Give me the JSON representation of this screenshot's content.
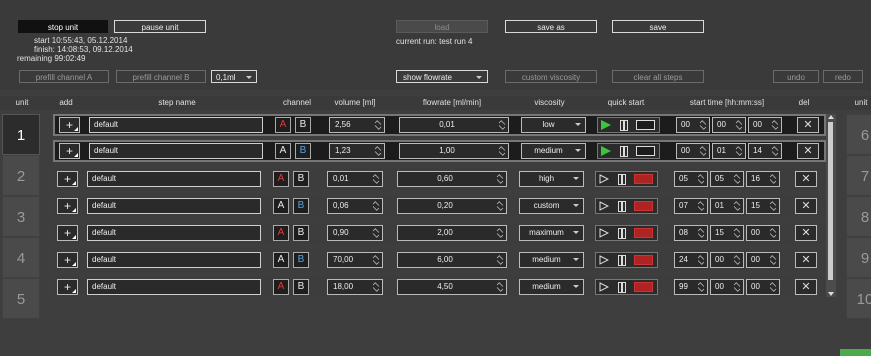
{
  "toolbar": {
    "stop_unit": "stop unit",
    "pause_unit": "pause unit",
    "load": "load",
    "save_as": "save as",
    "save": "save",
    "start": "start 10:55:43, 05.12.2014",
    "finish": "finish: 14:08:53, 09.12.2014",
    "remaining": "remaining 99:02:49",
    "current_run": "current run: test run 4",
    "prefill_a": "prefill channel A",
    "prefill_b": "prefill channel B",
    "prefill_amount": "0,1ml",
    "show_flowrate": "show flowrate",
    "custom_viscosity": "custom viscosity",
    "clear_all_steps": "clear all steps",
    "undo": "undo",
    "redo": "redo"
  },
  "headers": {
    "unit_left": "unit",
    "add": "add",
    "step_name": "step name",
    "channel": "channel",
    "volume": "volume [ml]",
    "flowrate": "flowrate [ml/min]",
    "viscosity": "viscosity",
    "quick_start": "quick start",
    "start_time": "start time [hh:mm:ss]",
    "del": "del",
    "unit_right": "unit"
  },
  "units_left": [
    "1",
    "2",
    "3",
    "4",
    "5"
  ],
  "units_right": [
    "6",
    "7",
    "8",
    "9",
    "10"
  ],
  "active_unit": "1",
  "channel_labels": {
    "a": "A",
    "b": "B"
  },
  "rows": [
    {
      "name": "default",
      "channel": "A",
      "volume": "2,56",
      "flowrate": "0,01",
      "viscosity": "low",
      "running": true,
      "h": "00",
      "m": "00",
      "s": "00"
    },
    {
      "name": "default",
      "channel": "B",
      "volume": "1,23",
      "flowrate": "1,00",
      "viscosity": "medium",
      "running": true,
      "h": "00",
      "m": "01",
      "s": "14"
    },
    {
      "name": "default",
      "channel": "A",
      "volume": "0,01",
      "flowrate": "0,60",
      "viscosity": "high",
      "running": false,
      "h": "05",
      "m": "05",
      "s": "16"
    },
    {
      "name": "default",
      "channel": "B",
      "volume": "0,06",
      "flowrate": "0,20",
      "viscosity": "custom",
      "running": false,
      "h": "07",
      "m": "01",
      "s": "15"
    },
    {
      "name": "default",
      "channel": "A",
      "volume": "0,90",
      "flowrate": "2,00",
      "viscosity": "maximum",
      "running": false,
      "h": "08",
      "m": "15",
      "s": "00"
    },
    {
      "name": "default",
      "channel": "B",
      "volume": "70,00",
      "flowrate": "6,00",
      "viscosity": "medium",
      "running": false,
      "h": "24",
      "m": "00",
      "s": "00"
    },
    {
      "name": "default",
      "channel": "A",
      "volume": "18,00",
      "flowrate": "4,50",
      "viscosity": "medium",
      "running": false,
      "h": "99",
      "m": "00",
      "s": "00"
    }
  ],
  "icons": {
    "add": "plus-icon",
    "del": "close-icon",
    "play": "play-icon",
    "pause": "pause-icon",
    "stop": "stop-icon"
  },
  "colors": {
    "channel_a": "#e03b3b",
    "channel_b": "#5aa0e6",
    "play": "#3cc43c",
    "stop_red": "#b02323"
  }
}
